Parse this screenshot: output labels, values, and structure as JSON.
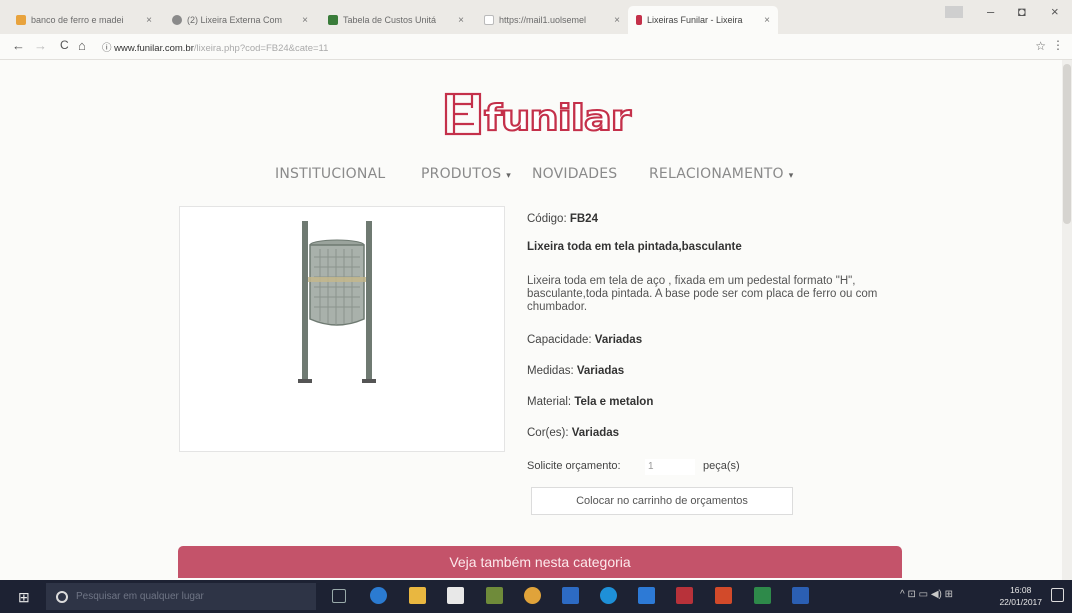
{
  "browser": {
    "tabs": [
      {
        "title": "banco de ferro e madei",
        "favicon_color": "#e8a33d"
      },
      {
        "title": "(2) Lixeira Externa Com",
        "favicon_color": "#8a8a8a"
      },
      {
        "title": "Tabela de Custos Unitá",
        "favicon_color": "#3a7c3a"
      },
      {
        "title": "https://mail1.uolsemel",
        "favicon_color": "#bbbbbb"
      },
      {
        "title": "Lixeiras Funilar - Lixeira",
        "favicon_color": "#c4304a"
      }
    ],
    "tab_close_glyph": "×",
    "window": {
      "minimize": "–",
      "maximize": "◘",
      "close": "×"
    },
    "url": {
      "info_glyph": "ⓘ",
      "host": "www.funilar.com.br",
      "path": "/lixeira.php?cod=FB24&cate=11"
    },
    "nav": {
      "back": "←",
      "forward": "→",
      "reload": "C",
      "home": "⌂"
    },
    "bookmark_glyph": "☆",
    "menu_glyph": "⋮"
  },
  "site": {
    "logo_text": "funilar",
    "colors": {
      "brand": "#c4304a",
      "category_bar": "#c4536a"
    },
    "nav": [
      {
        "label": "INSTITUCIONAL",
        "has_dropdown": false
      },
      {
        "label": "PRODUTOS",
        "has_dropdown": true
      },
      {
        "label": "NOVIDADES",
        "has_dropdown": false
      },
      {
        "label": "RELACIONAMENTO",
        "has_dropdown": true
      }
    ],
    "caret": "▾"
  },
  "product": {
    "code_label": "Código:",
    "code": "FB24",
    "title": "Lixeira toda em tela pintada,basculante",
    "description": "Lixeira toda em tela de aço , fixada em um pedestal formato \"H\", basculante,toda pintada. A base pode ser com placa de ferro ou com chumbador.",
    "capacity_label": "Capacidade:",
    "capacity": "Variadas",
    "measures_label": "Medidas:",
    "measures": "Variadas",
    "material_label": "Material:",
    "material": "Tela e metalon",
    "colors_label": "Cor(es):",
    "colors": "Variadas",
    "quote_label": "Solicite orçamento:",
    "quote_qty": "1",
    "quote_unit": "peça(s)",
    "cart_button": "Colocar no carrinho de orçamentos",
    "image_icon": "trash-bin-on-h-stand"
  },
  "category_banner": "Veja também nesta categoria",
  "taskbar": {
    "start_glyph": "⊞",
    "search_placeholder": "Pesquisar em qualquer lugar",
    "apps": [
      "task-view",
      "edge",
      "file-explorer",
      "store",
      "chrome",
      "mail",
      "skype",
      "acrobat",
      "powerpoint",
      "excel",
      "word"
    ],
    "tray": "^ ⊡ ▭ ◀) ⊞",
    "time": "16:08",
    "date": "22/01/2017"
  }
}
